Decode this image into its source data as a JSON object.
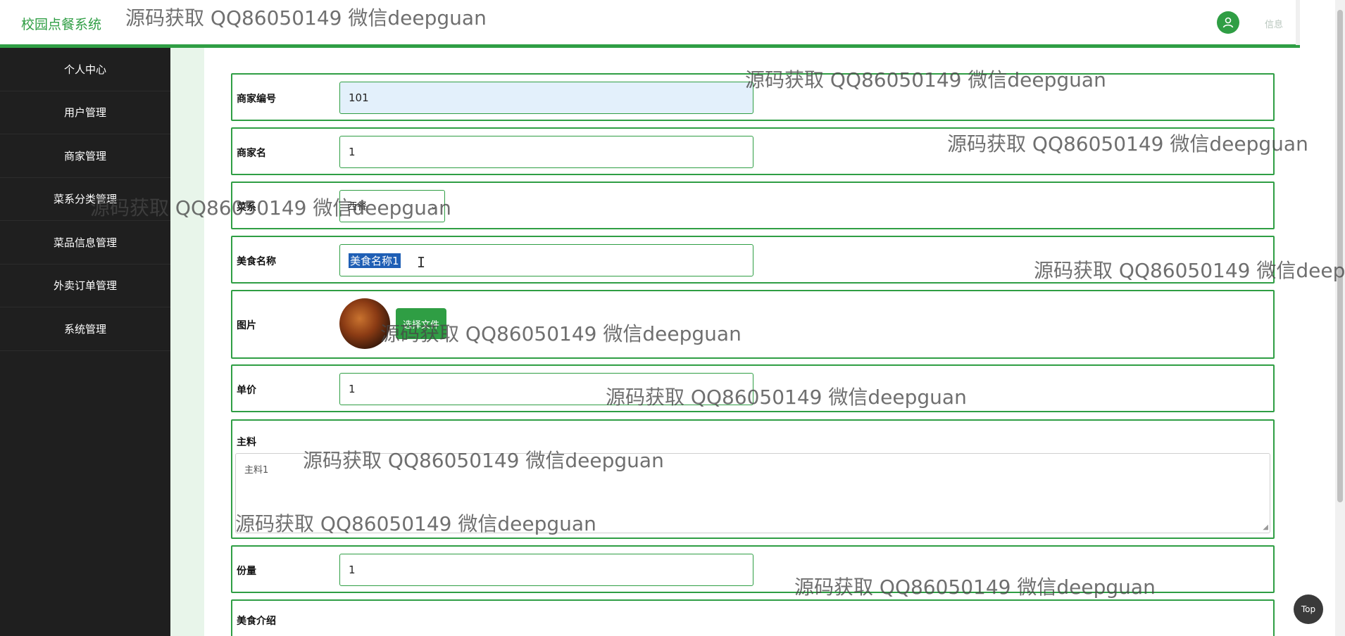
{
  "app": {
    "title": "校园点餐系统",
    "user_label": "信息"
  },
  "sidebar": {
    "items": [
      {
        "label": "个人中心"
      },
      {
        "label": "用户管理"
      },
      {
        "label": "商家管理"
      },
      {
        "label": "菜系分类管理"
      },
      {
        "label": "菜品信息管理"
      },
      {
        "label": "外卖订单管理"
      },
      {
        "label": "系统管理"
      }
    ]
  },
  "form": {
    "merchant_no": {
      "label": "商家编号",
      "value": "101"
    },
    "merchant_name": {
      "label": "商家名",
      "value": "1"
    },
    "cuisine": {
      "label": "菜系",
      "value": "西餐"
    },
    "food_name": {
      "label": "美食名称",
      "value": "美食名称1"
    },
    "image": {
      "label": "图片",
      "button": "选择文件"
    },
    "price": {
      "label": "单价",
      "value": "1"
    },
    "ingredients": {
      "label": "主料",
      "value": "主料1"
    },
    "portion": {
      "label": "份量",
      "value": "1"
    },
    "intro": {
      "label": "美食介绍"
    }
  },
  "top_button": "Top",
  "watermark": "源码获取 QQ86050149 微信deepguan",
  "colors": {
    "accent": "#2f9e44",
    "sidebar_bg": "#1f1f1f",
    "main_bg": "#e8f5ea"
  }
}
